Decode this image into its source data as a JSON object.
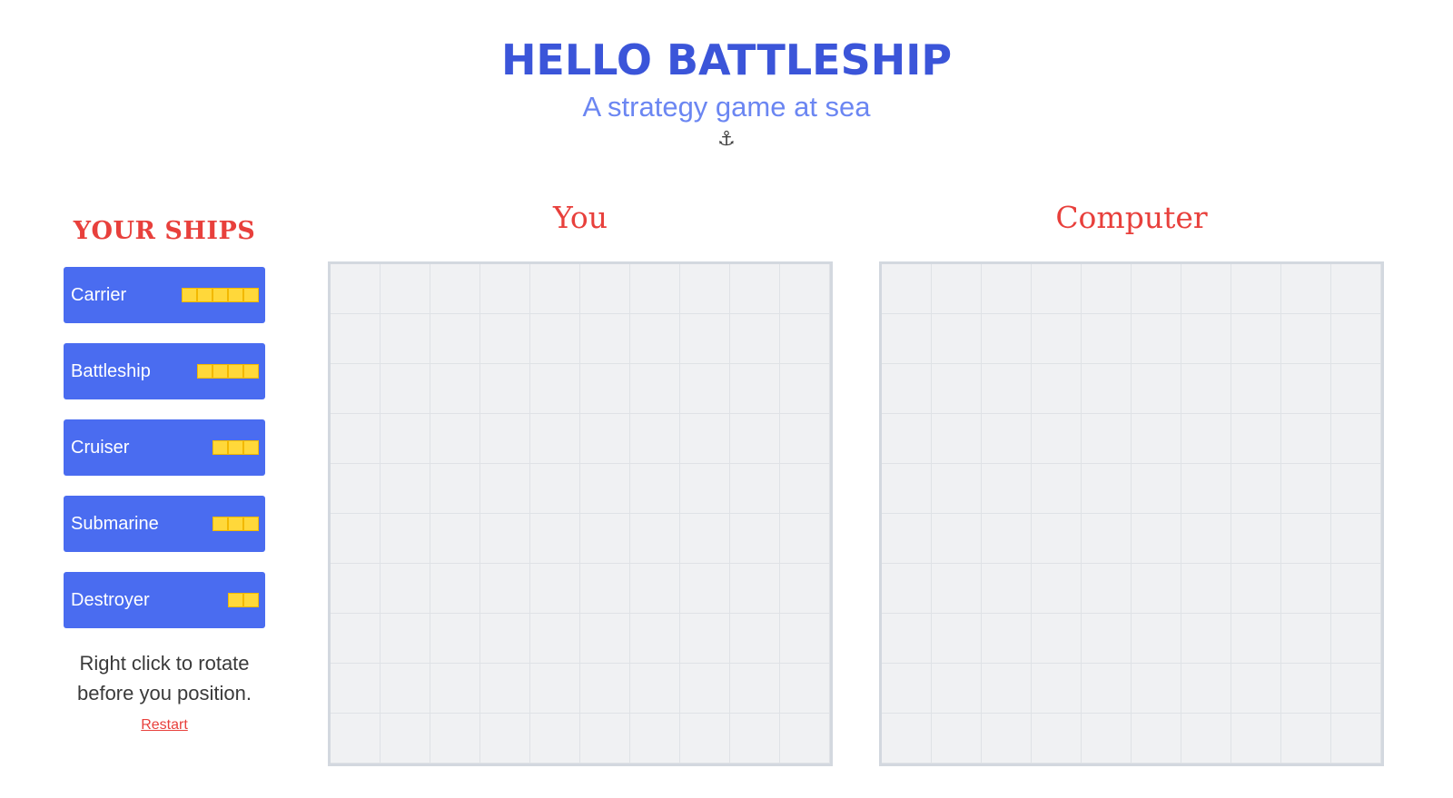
{
  "header": {
    "title": "HELLO BATTLESHIP",
    "subtitle": "A strategy game at sea",
    "anchor_glyph": "⚓"
  },
  "sidebar": {
    "heading": "YOUR SHIPS",
    "ships": [
      {
        "name": "Carrier",
        "length": 5
      },
      {
        "name": "Battleship",
        "length": 4
      },
      {
        "name": "Cruiser",
        "length": 3
      },
      {
        "name": "Submarine",
        "length": 3
      },
      {
        "name": "Destroyer",
        "length": 2
      }
    ],
    "hint_line1": "Right click to rotate",
    "hint_line2": "before you position.",
    "restart_label": "Restart"
  },
  "boards": {
    "player_label": "You",
    "computer_label": "Computer",
    "rows": 10,
    "cols": 10
  },
  "colors": {
    "ship_bg": "#4a6cf0",
    "ship_cell": "#ffd83a",
    "accent_red": "#e8403c",
    "title_blue": "#3b55d9"
  }
}
